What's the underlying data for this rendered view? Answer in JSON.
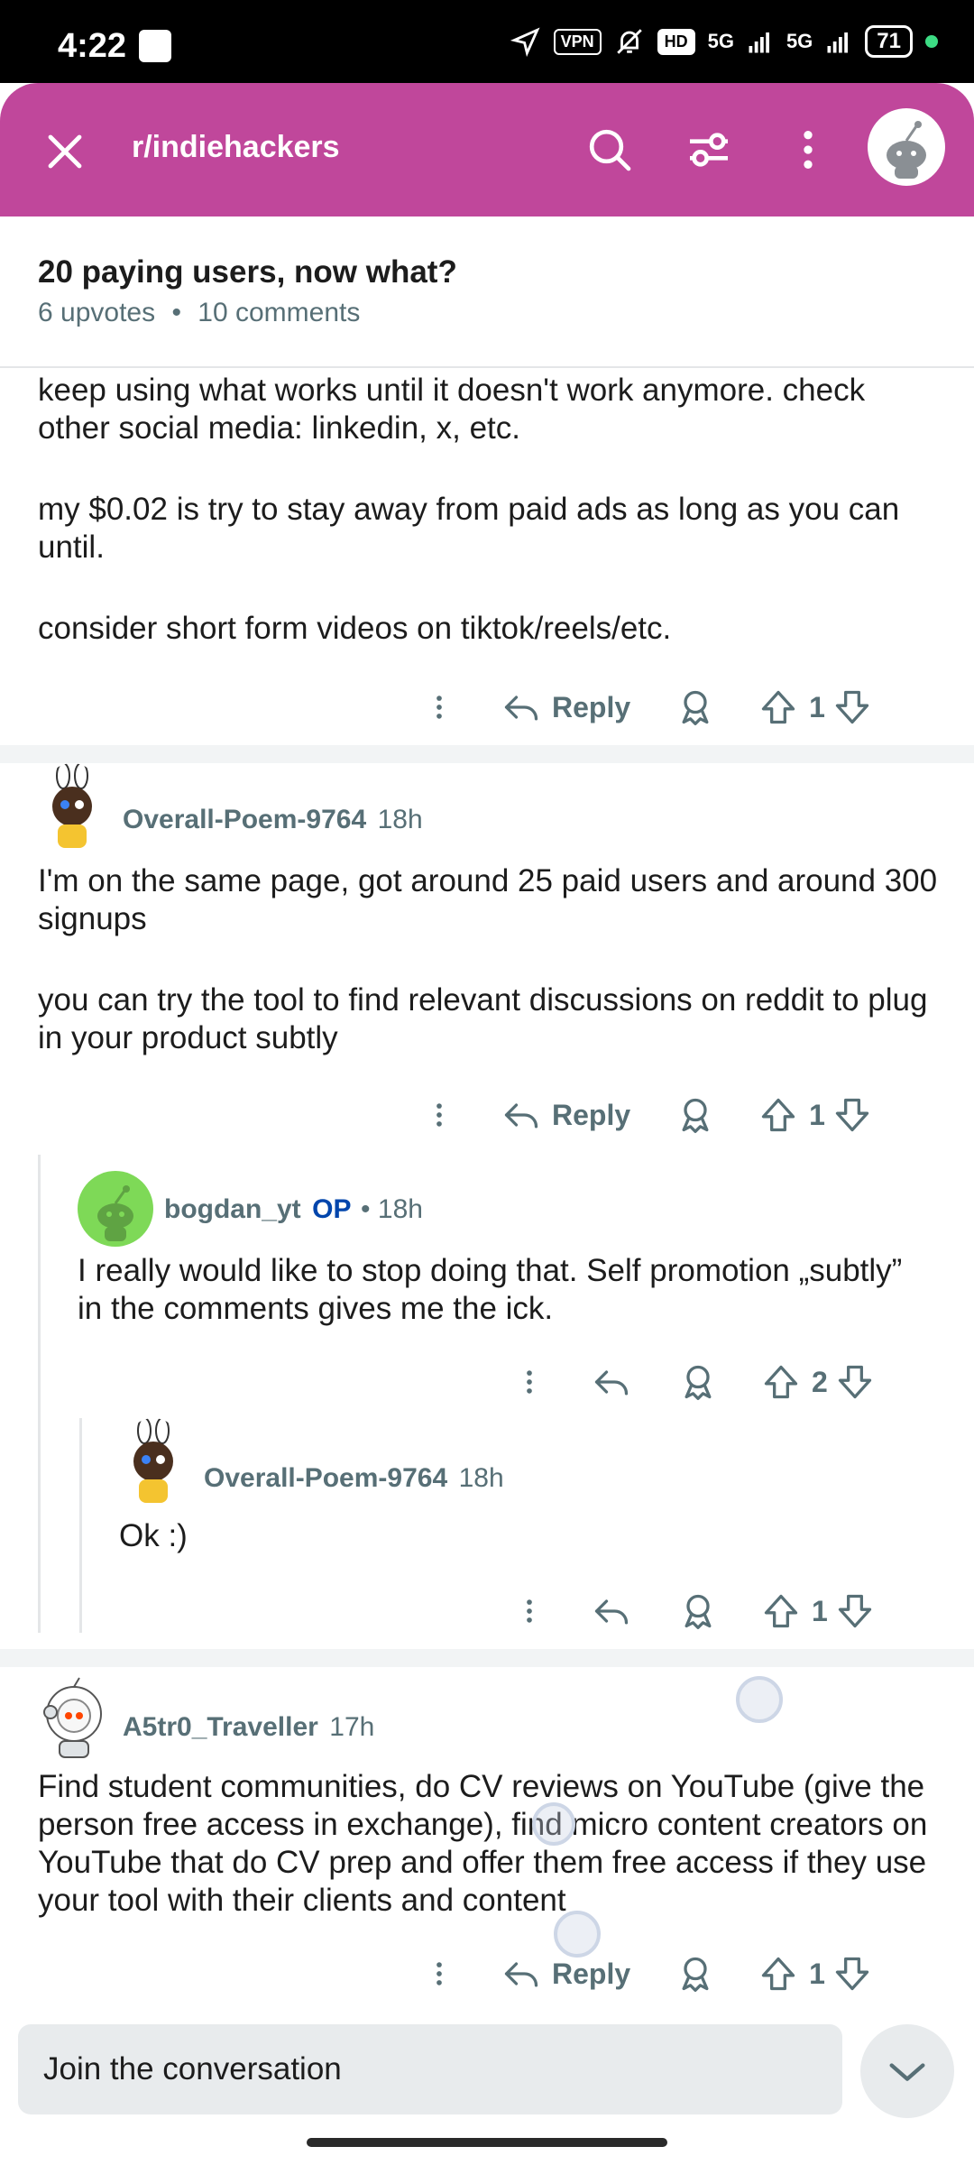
{
  "status": {
    "time": "4:22",
    "vpn": "VPN",
    "hd": "HD",
    "net1": "5G",
    "net2": "5G",
    "battery": "71"
  },
  "header": {
    "subreddit": "r/indiehackers"
  },
  "post": {
    "title": "20 paying users, now what?",
    "upvotes": "6 upvotes",
    "dot": "•",
    "comments": "10 comments"
  },
  "comment0": {
    "p1": "keep using what works until it doesn't work anymore. check other social media: linkedin, x, etc.",
    "p2": "my $0.02 is try to stay away from paid ads as long as you can until.",
    "p3": "consider short form videos on tiktok/reels/etc.",
    "reply": "Reply",
    "votes": "1"
  },
  "comment1": {
    "user": "Overall-Poem-9764",
    "time": "18h",
    "p1": "I'm on the same page, got around 25 paid users and around 300 signups",
    "p2": "you can try the tool to find relevant discussions on reddit to plug in your product subtly",
    "reply": "Reply",
    "votes": "1"
  },
  "comment2": {
    "user": "bogdan_yt",
    "op": "OP",
    "dot": "•",
    "time": "18h",
    "p1": "I really would like to stop doing that. Self promotion „subtly” in the comments gives me the ick.",
    "votes": "2"
  },
  "comment3": {
    "user": "Overall-Poem-9764",
    "time": "18h",
    "p1": "Ok :)",
    "votes": "1"
  },
  "comment4": {
    "user": "A5tr0_Traveller",
    "time": "17h",
    "p1": "Find student communities, do CV reviews on YouTube (give the person free access in exchange), find micro content creators on YouTube that do CV prep and offer them free access if they use your tool with their clients and content",
    "reply": "Reply",
    "votes": "1"
  },
  "composer": {
    "placeholder": "Join the conversation"
  },
  "icons": [
    "close-icon",
    "search-icon",
    "filter-icon",
    "more-vertical-icon",
    "reply-icon",
    "award-icon",
    "upvote-icon",
    "downvote-icon",
    "chevron-down-icon"
  ],
  "colors": {
    "header": "#c0479b",
    "meta": "#576f76",
    "op": "#0045ac"
  }
}
